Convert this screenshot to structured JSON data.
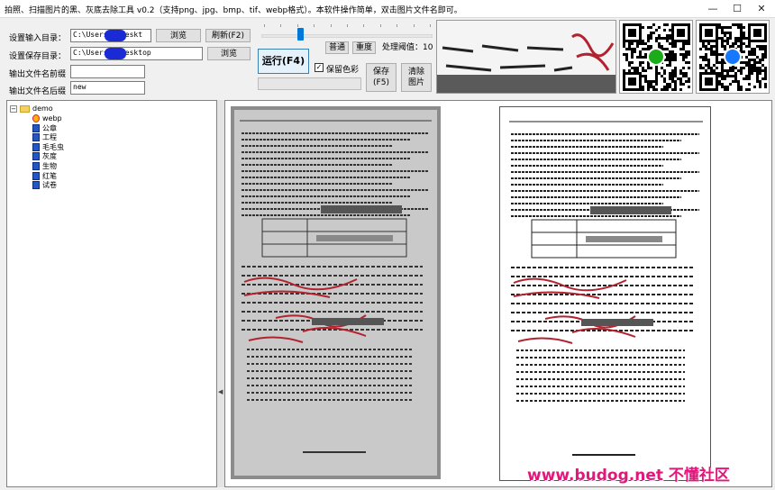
{
  "window": {
    "title": "拍照、扫描图片的黑、灰底去除工具 v0.2（支持png、jpg、bmp、tif、webp格式）。本软件操作简单，双击图片文件名即可。",
    "minimize": "—",
    "maximize": "☐",
    "close": "✕"
  },
  "form": {
    "input_dir_label": "设置输入目录：",
    "input_dir_value": "C:\\Users\\ \\Deskt",
    "save_dir_label": "设置保存目录：",
    "save_dir_value": "C:\\Users\\ \\Desktop",
    "prefix_label": "输出文件名前缀",
    "prefix_value": "",
    "suffix_label": "输出文件名后缀",
    "suffix_value": "new"
  },
  "buttons": {
    "browse1": "浏览",
    "refresh": "刷新(F2)",
    "browse2": "浏览",
    "run": "运行(F4)",
    "normal": "普通",
    "heavy": "重度",
    "save_line1": "保存",
    "save_line2": "(F5)",
    "clear_line1": "清除",
    "clear_line2": "图片"
  },
  "threshold": {
    "label": "处理阈值：",
    "value": "10",
    "level": 0.22
  },
  "keep_color": {
    "label": "保留色彩",
    "checked": true,
    "mark": "✓"
  },
  "tree": {
    "root": "demo",
    "root_toggle": "−",
    "items": [
      "webp",
      "公章",
      "工程",
      "毛毛虫",
      "灰度",
      "生物",
      "红笔",
      "试卷"
    ]
  },
  "watermark": "www.budog.net 不懂社区",
  "icons": {
    "folder": "folder-icon",
    "file": "image-file-icon",
    "webp": "webp-file-icon",
    "grip": "◀"
  }
}
